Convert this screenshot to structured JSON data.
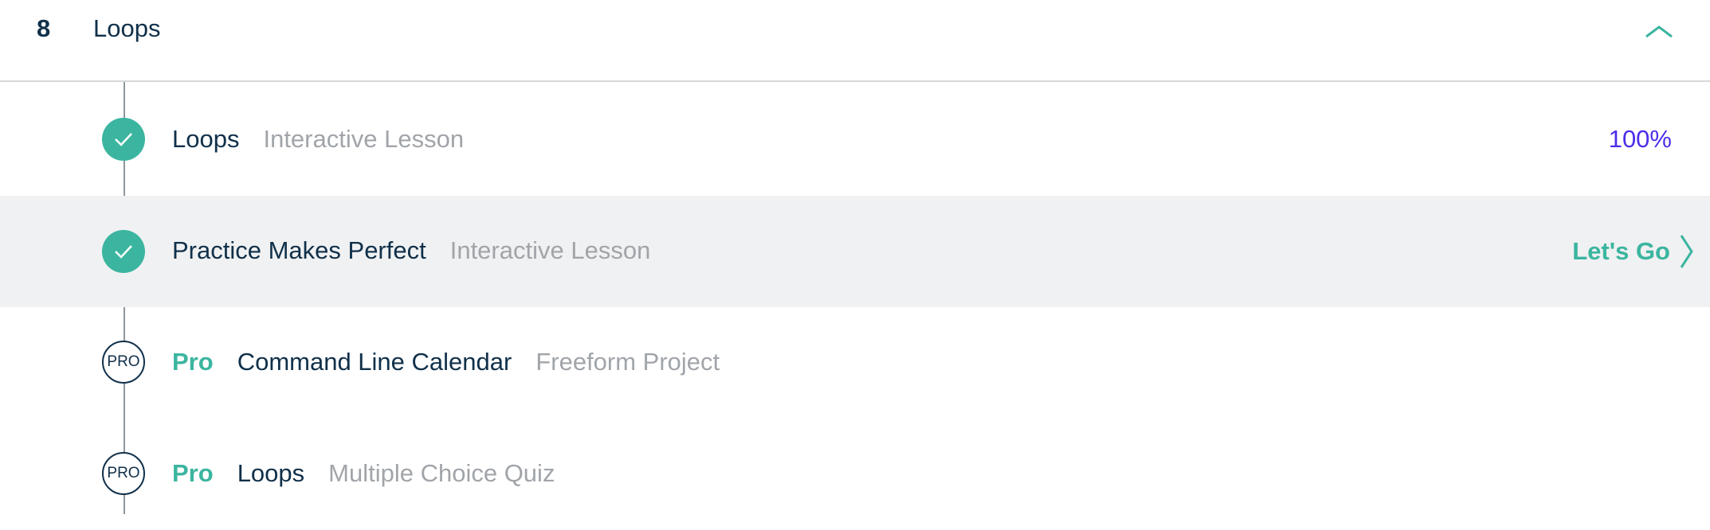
{
  "section": {
    "number": "8",
    "title": "Loops",
    "toggle_icon": "chevron-up-icon"
  },
  "colors": {
    "accent": "#3bb5a0",
    "progress": "#4c2eea",
    "title": "#10304a",
    "muted": "#a1a5a9",
    "highlight_bg": "#f0f1f2"
  },
  "lessons": [
    {
      "status": "completed",
      "status_icon": "check-icon",
      "title": "Loops",
      "type": "Interactive Lesson",
      "progress": "100%"
    },
    {
      "status": "completed",
      "status_icon": "check-icon",
      "title": "Practice Makes Perfect",
      "type": "Interactive Lesson",
      "action_label": "Let's Go",
      "action_icon": "chevron-right-icon"
    },
    {
      "status": "pro",
      "status_badge": "PRO",
      "pro_label": "Pro",
      "title": "Command Line Calendar",
      "type": "Freeform Project"
    },
    {
      "status": "pro",
      "status_badge": "PRO",
      "pro_label": "Pro",
      "title": "Loops",
      "type": "Multiple Choice Quiz"
    }
  ]
}
